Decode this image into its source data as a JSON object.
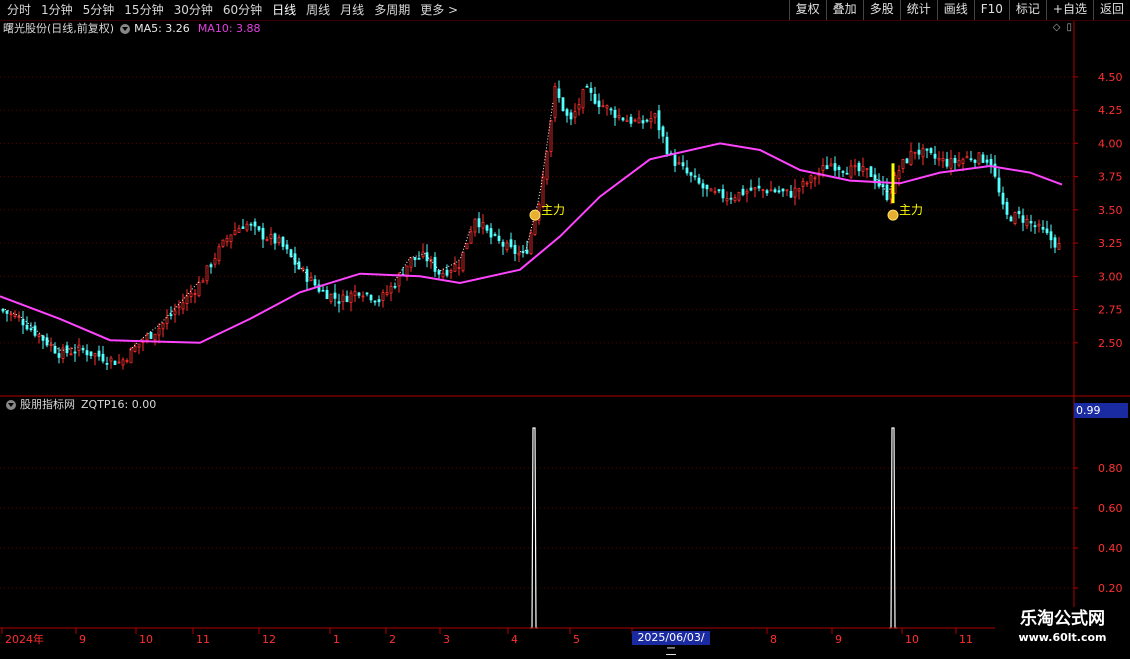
{
  "toolbar": {
    "periods": [
      "分时",
      "1分钟",
      "5分钟",
      "15分钟",
      "30分钟",
      "60分钟",
      "日线",
      "周线",
      "月线",
      "多周期",
      "更多 >"
    ],
    "active_period": "日线",
    "actions": [
      "复权",
      "叠加",
      "多股",
      "统计",
      "画线",
      "F10",
      "标记",
      "+自选",
      "返回"
    ]
  },
  "main_chart": {
    "title": "曙光股份(日线,前复权)",
    "ma5_label": "MA5: 3.26",
    "ma10_label": "MA10: 3.88",
    "signal_label": "主力",
    "colors": {
      "up": "#ff3030",
      "down": "#54ffff",
      "ma": "#ff44ff",
      "signal_bar": "#ffff00",
      "dotted": "#ffffff"
    }
  },
  "indicator": {
    "name": "股朋指标网",
    "value_label": "ZQTP16: 0.00",
    "cursor_value": "0.99"
  },
  "cursor_date": "2025/06/03/二",
  "logo": {
    "main": "乐淘公式网",
    "url": "www.60lt.com"
  },
  "chart_data": [
    {
      "type": "candlestick",
      "title": "曙光股份(日线,前复权)",
      "y_ticks": [
        "4.50",
        "4.25",
        "4.00",
        "3.75",
        "3.50",
        "3.25",
        "3.00",
        "2.75",
        "2.50"
      ],
      "ylim": [
        2.1,
        4.8
      ],
      "x_ticks": [
        "2024年",
        "9",
        "10",
        "11",
        "12",
        "1",
        "2",
        "3",
        "4",
        "5",
        "2025/06/03/二",
        "8",
        "9",
        "10",
        "11"
      ],
      "series": [
        {
          "name": "MA10",
          "values_approx": {
            "start": 2.85,
            "low": 2.5,
            "mid": 3.0,
            "peak": 4.0,
            "end": 3.7
          }
        }
      ],
      "grid": true
    },
    {
      "type": "line",
      "title": "股朋指标网",
      "series": [
        {
          "name": "ZQTP16",
          "spikes_at": [
            "2025-04",
            "2025-09"
          ],
          "spike_value": 1.0
        }
      ],
      "y_ticks": [
        "0.80",
        "0.60",
        "0.40",
        "0.20"
      ],
      "ylim": [
        0,
        1.0
      ]
    }
  ]
}
